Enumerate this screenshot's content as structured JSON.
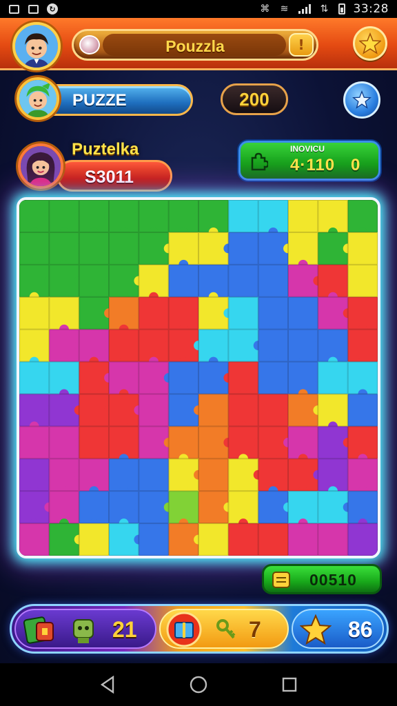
{
  "status_bar": {
    "time": "33:28",
    "icons": [
      "gallery-icon",
      "image-icon",
      "app-icon",
      "vibrate-icon",
      "wifi-icon",
      "signal-icon",
      "data-icon",
      "battery-icon"
    ]
  },
  "header": {
    "title": "Pouzzla",
    "title_left_icon": "candy-icon",
    "title_right_icon": "hint-icon",
    "right_button_icon": "star-icon"
  },
  "player_bar": {
    "name": "PUZZE",
    "score": "200",
    "button_icon": "star-icon"
  },
  "opponent": {
    "name": "Puztelka",
    "score": "S3011"
  },
  "stats_panel": {
    "label": "INOVICU",
    "value": "4·110",
    "value2": "0"
  },
  "board": {
    "rows": 11,
    "cols": 12,
    "palette": {
      "green": "#22b02a",
      "yellow": "#f2e61e",
      "cyan": "#2ad4ee",
      "blue": "#2a6ee8",
      "red": "#ee2a2a",
      "orange": "#f2741a",
      "magenta": "#d42aa6",
      "purple": "#8a2ad0",
      "lime": "#7ad02a"
    },
    "tiles": [
      "GGGGGGGCCYYG",
      "GGGGGYYBBYGY",
      "GGGGYBBBBMRY",
      "YYGORRYCBBMR",
      "YMMRRRCCBBBR",
      "CCRMMBBRBBCC",
      "PPRRMBORROYB",
      "MMRRMOORRMPR",
      "PMMBBYOYRRPM",
      "PMBBBLOYBCCB",
      "MGYCBOYRRMMP"
    ]
  },
  "bottom_stat": {
    "value": "00510"
  },
  "toolbar": {
    "items": [
      {
        "label": "21",
        "icon": "puzzle-pieces-icon"
      },
      {
        "label": "7",
        "icon": "gift-box-icon"
      },
      {
        "label": "86",
        "icon": "star-icon"
      }
    ]
  },
  "nav": {
    "items": [
      "back-icon",
      "home-icon",
      "recents-icon"
    ]
  },
  "colors": {
    "header": "#e44a12",
    "accent_yellow": "#ffd23a",
    "board_glow": "#4ef6ff"
  }
}
